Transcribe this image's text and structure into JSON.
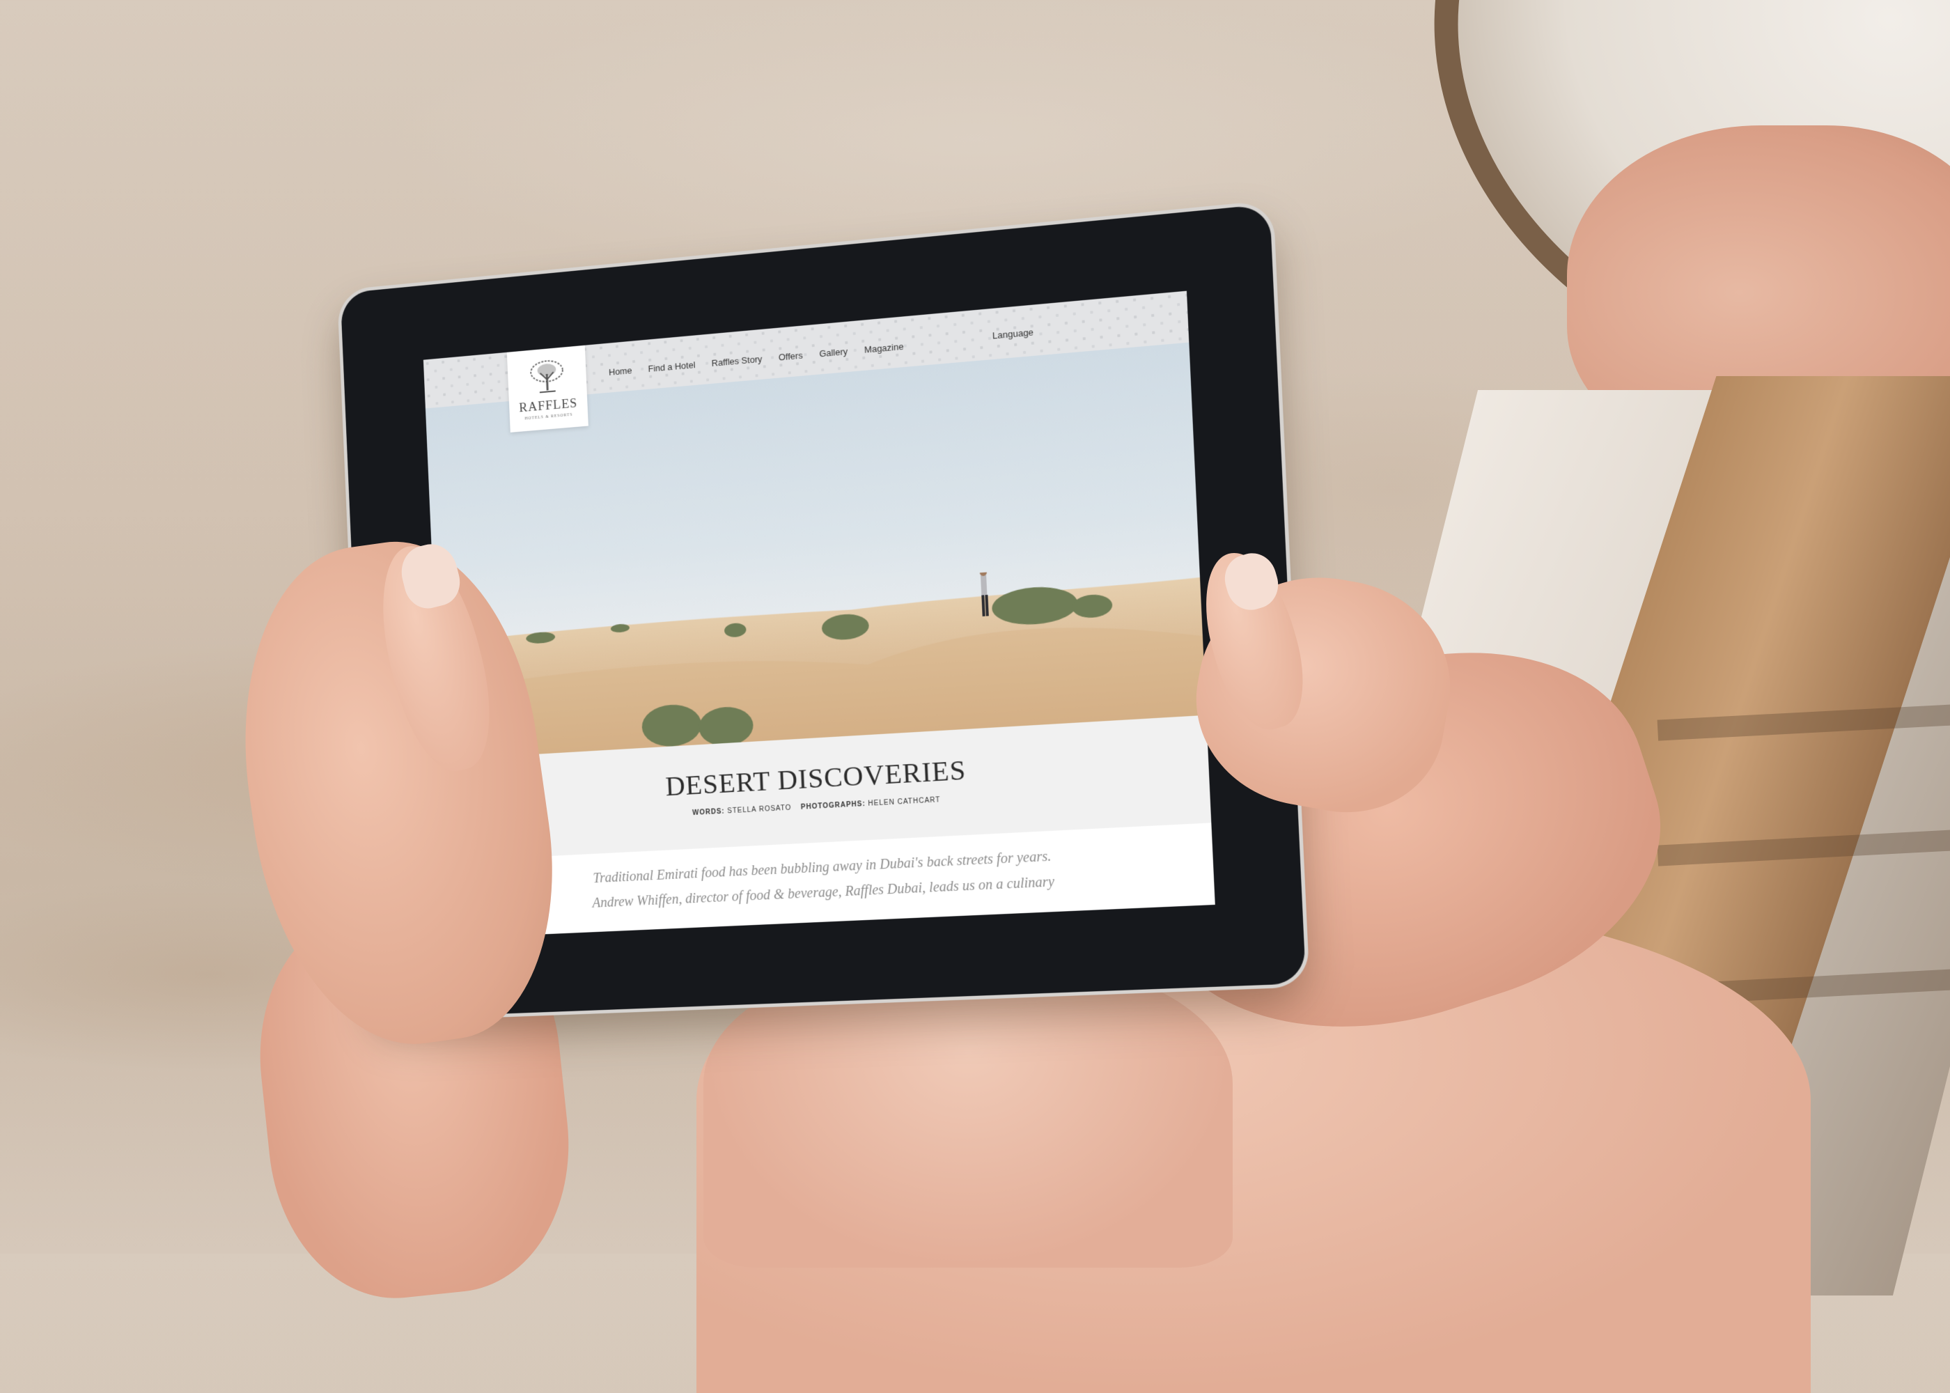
{
  "site": {
    "logo_name": "RAFFLES",
    "logo_sub": "HOTELS & RESORTS",
    "nav": [
      "Home",
      "Find a Hotel",
      "Raffles Story",
      "Offers",
      "Gallery",
      "Magazine"
    ],
    "language": "Language"
  },
  "article": {
    "title": "Desert Discoveries",
    "words_label": "WORDS:",
    "words_value": "STELLA ROSATO",
    "photos_label": "PHOTOGRAPHS:",
    "photos_value": "HELEN CATHCART",
    "intro_line1": "Traditional Emirati food has been bubbling away in Dubai's back streets for years.",
    "intro_line2": "Andrew Whiffen, director of food & beverage, Raffles Dubai, leads us on a culinary"
  },
  "colors": {
    "header_bg": "#e3e4e6",
    "title_band": "#f1f1f1",
    "tablet_bezel": "#16181c",
    "intro_text": "#8d8d8d"
  }
}
